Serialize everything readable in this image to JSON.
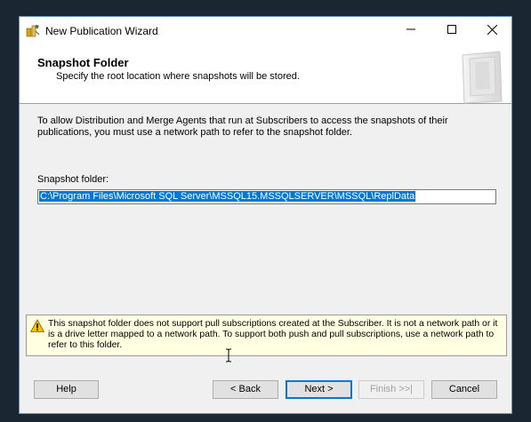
{
  "window": {
    "title": "New Publication Wizard"
  },
  "titlebar": {
    "minimize_icon": "minimize-icon",
    "maximize_icon": "maximize-icon",
    "close_icon": "close-icon"
  },
  "header": {
    "title": "Snapshot Folder",
    "subtitle": "Specify the root location where snapshots will be stored."
  },
  "main": {
    "description": "To allow Distribution and Merge Agents that run at Subscribers to access the snapshots of their publications, you must use a network path to refer to the snapshot folder.",
    "snapshot_label": "Snapshot folder:",
    "snapshot_value": "C:\\Program Files\\Microsoft SQL Server\\MSSQL15.MSSQLSERVER\\MSSQL\\ReplData"
  },
  "warning": {
    "icon": "warning-icon",
    "text": "This snapshot folder does not support pull subscriptions created at the Subscriber. It is not a network path or it is a drive letter mapped to a network path. To support both push and pull subscriptions, use a network path to refer to this folder."
  },
  "buttons": {
    "help": "Help",
    "back": "< Back",
    "next": "Next >",
    "finish": "Finish >>|",
    "cancel": "Cancel"
  },
  "colors": {
    "accent": "#0078d7",
    "warning_bg": "#ffffe1"
  }
}
